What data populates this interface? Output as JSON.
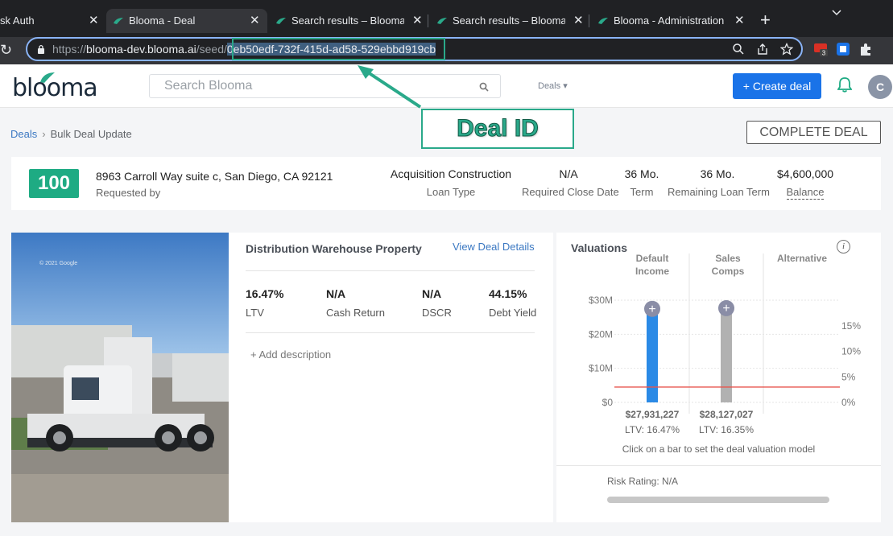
{
  "browser": {
    "tabs": [
      {
        "title": "sk Auth"
      },
      {
        "title": "Blooma - Deal"
      },
      {
        "title": "Search results – Blooma.ai"
      },
      {
        "title": "Search results – Blooma.ai"
      },
      {
        "title": "Blooma - Administration"
      }
    ],
    "new_tab": "+",
    "url_prefix": "https://",
    "url_host": "blooma-dev.blooma.ai",
    "url_path": "/seed/",
    "url_selected": "0eb50edf-732f-415d-ad58-529ebbd919cb",
    "extension_badge": "3"
  },
  "header": {
    "logo": "blooma",
    "search_placeholder": "Search Blooma",
    "deals_menu": "Deals",
    "create_deal": "Create deal",
    "avatar_initial": "C"
  },
  "breadcrumb": {
    "deals": "Deals",
    "current": "Bulk Deal Update"
  },
  "complete_deal": "COMPLETE DEAL",
  "annotation": {
    "label": "Deal ID",
    "color": "#2aa98a"
  },
  "summary": {
    "score": "100",
    "address": "8963 Carroll Way suite c, San Diego, CA 92121",
    "requested_by": "Requested by",
    "loan_type_value": "Acquisition Construction",
    "loan_type_label": "Loan Type",
    "close_date_value": "N/A",
    "close_date_label": "Required Close Date",
    "term_value": "36 Mo.",
    "term_label": "Term",
    "remaining_value": "36 Mo.",
    "remaining_label": "Remaining Loan Term",
    "balance_value": "$4,600,000",
    "balance_label": "Balance"
  },
  "property": {
    "title": "Distribution Warehouse Property",
    "view_details": "View Deal Details",
    "metrics": [
      {
        "value": "16.47%",
        "label": "LTV"
      },
      {
        "value": "N/A",
        "label": "Cash Return"
      },
      {
        "value": "N/A",
        "label": "DSCR"
      },
      {
        "value": "44.15%",
        "label": "Debt Yield"
      }
    ],
    "add_description": "+ Add description",
    "photo_watermark": "© 2021 Google"
  },
  "valuations": {
    "title": "Valuations",
    "info": "i",
    "columns": [
      {
        "line1": "Default",
        "line2": "Income"
      },
      {
        "line1": "Sales",
        "line2": "Comps"
      },
      {
        "line1": "Alternative",
        "line2": ""
      }
    ],
    "hint": "Click on a bar to set the deal valuation model",
    "risk_rating": "Risk Rating: N/A"
  },
  "chart_data": {
    "type": "bar",
    "categories": [
      "Default Income",
      "Sales Comps"
    ],
    "values": [
      27931227,
      28127027
    ],
    "value_labels": [
      "$27,931,227",
      "$28,127,027"
    ],
    "ltv_labels": [
      "LTV: 16.47%",
      "LTV: 16.35%"
    ],
    "bar_colors": [
      "#2b8ae6",
      "#b1b1b1"
    ],
    "ylim": [
      0,
      30000000
    ],
    "y_ticks": [
      "$0",
      "$10M",
      "$20M",
      "$30M"
    ],
    "y2_ticks": [
      "0%",
      "5%",
      "10%",
      "15%"
    ],
    "y2lim": [
      0,
      20
    ],
    "threshold_pct": 3,
    "threshold_color": "#e8554e",
    "grid": true
  }
}
